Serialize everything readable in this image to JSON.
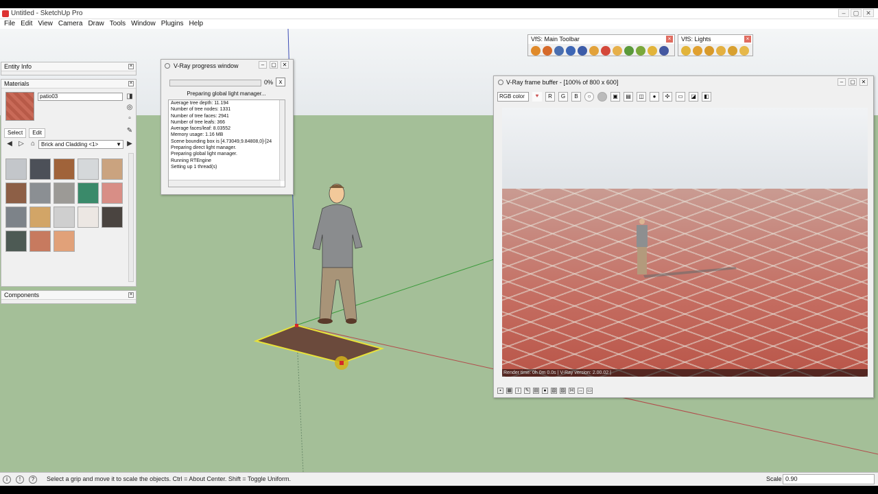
{
  "window": {
    "title": "Untitled - SketchUp Pro"
  },
  "menu": [
    "File",
    "Edit",
    "View",
    "Camera",
    "Draw",
    "Tools",
    "Window",
    "Plugins",
    "Help"
  ],
  "entity_info": {
    "title": "Entity Info"
  },
  "materials": {
    "title": "Materials",
    "current_name": "patio03",
    "tabs": [
      "Select",
      "Edit"
    ],
    "library": "Brick and Cladding <1>",
    "swatch_colors": [
      "#c3c6ca",
      "#4c5058",
      "#a0633a",
      "#d5d8da",
      "#caa37f",
      "#8d5f46",
      "#8b8f93",
      "#9c9a96",
      "#3a8a6a",
      "#d88e86",
      "#7d8389",
      "#d2a567",
      "#cfcfcf",
      "#ece7e3",
      "#4a4440",
      "#4d5a54",
      "#c77a5f",
      "#e1a179"
    ]
  },
  "components": {
    "title": "Components"
  },
  "vray_progress": {
    "title": "V-Ray progress window",
    "percent_label": "0%",
    "progress": 0,
    "status": "Preparing global light manager...",
    "cancel": "x",
    "log": [
      "Average tree depth: 11.194",
      "Number of tree nodes: 1331",
      "Number of tree faces: 2941",
      "Number of tree leafs: 366",
      "Average faces/leaf: 8.03552",
      "Memory usage: 1.16 MB",
      "Scene bounding box is [4.73049,9.84808,0]-[24",
      "Preparing direct light manager.",
      "Preparing global light manager.",
      "Running RTEngine",
      "Setting up 1 thread(s)"
    ]
  },
  "toolbar_main": {
    "title": "VfS: Main Toolbar",
    "icon_colors": [
      "#e08a2a",
      "#d66a2a",
      "#4a6fb0",
      "#3d66b5",
      "#3c5ca8",
      "#e2a23a",
      "#d4483a",
      "#e6b04a",
      "#5a9a3a",
      "#7aa83a",
      "#e2b43a",
      "#4458a0"
    ]
  },
  "toolbar_lights": {
    "title": "VfS: Lights",
    "icon_colors": [
      "#e2b43a",
      "#e0a030",
      "#d89a2a",
      "#e4b040",
      "#d8a030",
      "#e6b84a"
    ]
  },
  "frame_buffer": {
    "title": "V-Ray frame buffer - [100% of 800 x 600]",
    "channel": "RGB color",
    "buttons": [
      "R",
      "G",
      "B"
    ],
    "render_info": "Render time: 0h 0m 0.0s | V-Ray version: 2.00.02 |"
  },
  "status": {
    "message": "Select a grip and move it to scale the objects. Ctrl = About Center. Shift = Toggle Uniform.",
    "scale_label": "Scale",
    "scale_value": "0.90"
  }
}
